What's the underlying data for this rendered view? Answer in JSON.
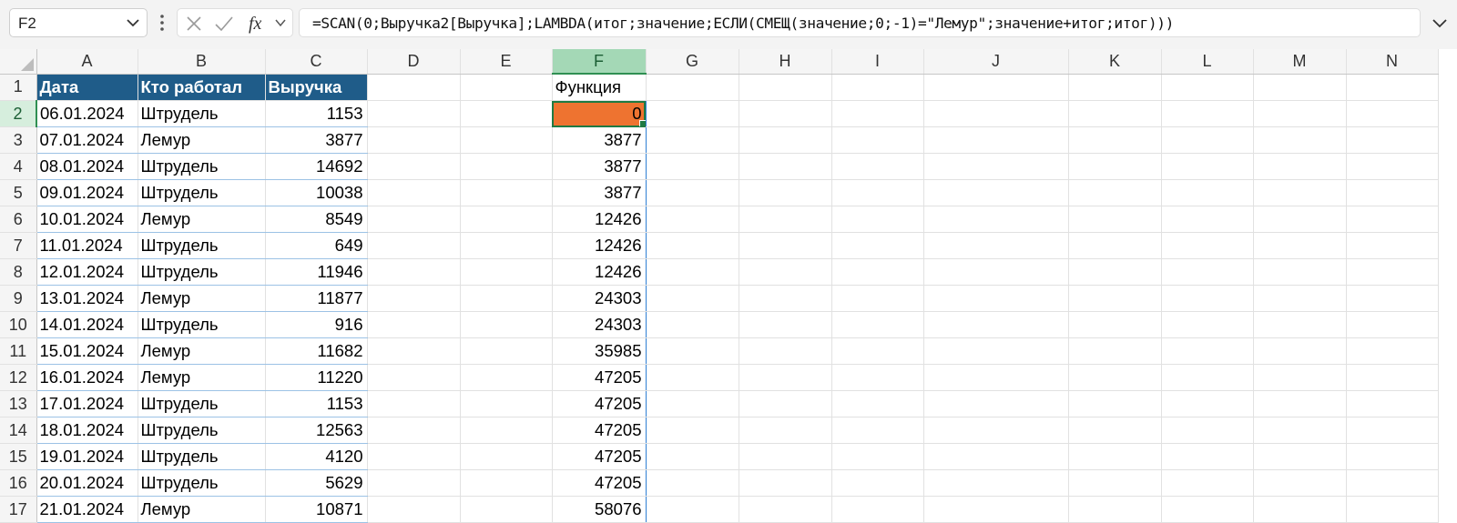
{
  "name_box": "F2",
  "formula": "=SCAN(0;Выручка2[Выручка];LAMBDA(итог;значение;ЕСЛИ(СМЕЩ(значение;0;-1)=\"Лемур\";значение+итог;итог)))",
  "icons": {
    "name_box_dropdown": "chevron-down-icon",
    "more": "vertical-dots-icon",
    "cancel": "x-icon",
    "enter": "check-icon",
    "insert_function": "fx-icon",
    "function_dropdown": "chevron-down-icon",
    "expand": "chevron-down-icon"
  },
  "colors": {
    "table_header": "#1f5c89",
    "active_cell": "#ee7330",
    "selection": "#1f7a43",
    "spill_border": "#2f7fd4"
  },
  "columns": [
    "A",
    "B",
    "C",
    "D",
    "E",
    "F",
    "G",
    "H",
    "I",
    "J",
    "K",
    "L",
    "M",
    "N"
  ],
  "selected_column": "F",
  "selected_row": "2",
  "table_headers": [
    "Дата",
    "Кто работал",
    "Выручка"
  ],
  "function_header": "Функция",
  "rows": [
    {
      "n": "2",
      "date": "06.01.2024",
      "who": "Штрудель",
      "rev": "1153",
      "fn": "0"
    },
    {
      "n": "3",
      "date": "07.01.2024",
      "who": "Лемур",
      "rev": "3877",
      "fn": "3877"
    },
    {
      "n": "4",
      "date": "08.01.2024",
      "who": "Штрудель",
      "rev": "14692",
      "fn": "3877"
    },
    {
      "n": "5",
      "date": "09.01.2024",
      "who": "Штрудель",
      "rev": "10038",
      "fn": "3877"
    },
    {
      "n": "6",
      "date": "10.01.2024",
      "who": "Лемур",
      "rev": "8549",
      "fn": "12426"
    },
    {
      "n": "7",
      "date": "11.01.2024",
      "who": "Штрудель",
      "rev": "649",
      "fn": "12426"
    },
    {
      "n": "8",
      "date": "12.01.2024",
      "who": "Штрудель",
      "rev": "11946",
      "fn": "12426"
    },
    {
      "n": "9",
      "date": "13.01.2024",
      "who": "Лемур",
      "rev": "11877",
      "fn": "24303"
    },
    {
      "n": "10",
      "date": "14.01.2024",
      "who": "Штрудель",
      "rev": "916",
      "fn": "24303"
    },
    {
      "n": "11",
      "date": "15.01.2024",
      "who": "Лемур",
      "rev": "11682",
      "fn": "35985"
    },
    {
      "n": "12",
      "date": "16.01.2024",
      "who": "Лемур",
      "rev": "11220",
      "fn": "47205"
    },
    {
      "n": "13",
      "date": "17.01.2024",
      "who": "Штрудель",
      "rev": "1153",
      "fn": "47205"
    },
    {
      "n": "14",
      "date": "18.01.2024",
      "who": "Штрудель",
      "rev": "12563",
      "fn": "47205"
    },
    {
      "n": "15",
      "date": "19.01.2024",
      "who": "Штрудель",
      "rev": "4120",
      "fn": "47205"
    },
    {
      "n": "16",
      "date": "20.01.2024",
      "who": "Штрудель",
      "rev": "5629",
      "fn": "47205"
    },
    {
      "n": "17",
      "date": "21.01.2024",
      "who": "Лемур",
      "rev": "10871",
      "fn": "58076"
    }
  ]
}
